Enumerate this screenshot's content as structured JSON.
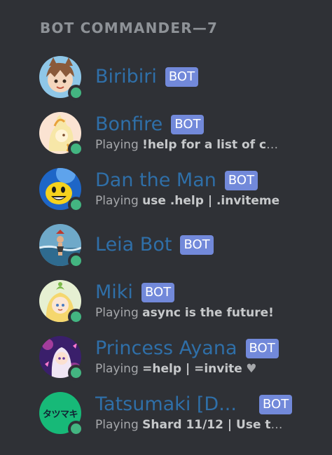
{
  "group_header": "BOT COMMANDER—7",
  "bot_tag": "BOT",
  "status_color": "#43b581",
  "members": [
    {
      "name": "Biribiri",
      "activity_prefix": "",
      "activity": "",
      "status": "online"
    },
    {
      "name": "Bonfire",
      "activity_prefix": "Playing",
      "activity": "!help for a list of co...",
      "status": "online"
    },
    {
      "name": "Dan the Man",
      "activity_prefix": "Playing",
      "activity": "use .help | .inviteme",
      "status": "online"
    },
    {
      "name": "Leia Bot",
      "activity_prefix": "",
      "activity": "",
      "status": "online"
    },
    {
      "name": "Miki",
      "activity_prefix": "Playing",
      "activity": "async is the future!",
      "status": "online"
    },
    {
      "name": "Princess Ayana",
      "activity_prefix": "Playing",
      "activity": "=help | =invite",
      "activity_icon": "heart-icon",
      "status": "online"
    },
    {
      "name": "Tatsumaki [D...",
      "activity_prefix": "Playing",
      "activity": "Shard 11/12 | Use t!h...",
      "avatar_text": "タツマキ",
      "status": "online"
    }
  ]
}
